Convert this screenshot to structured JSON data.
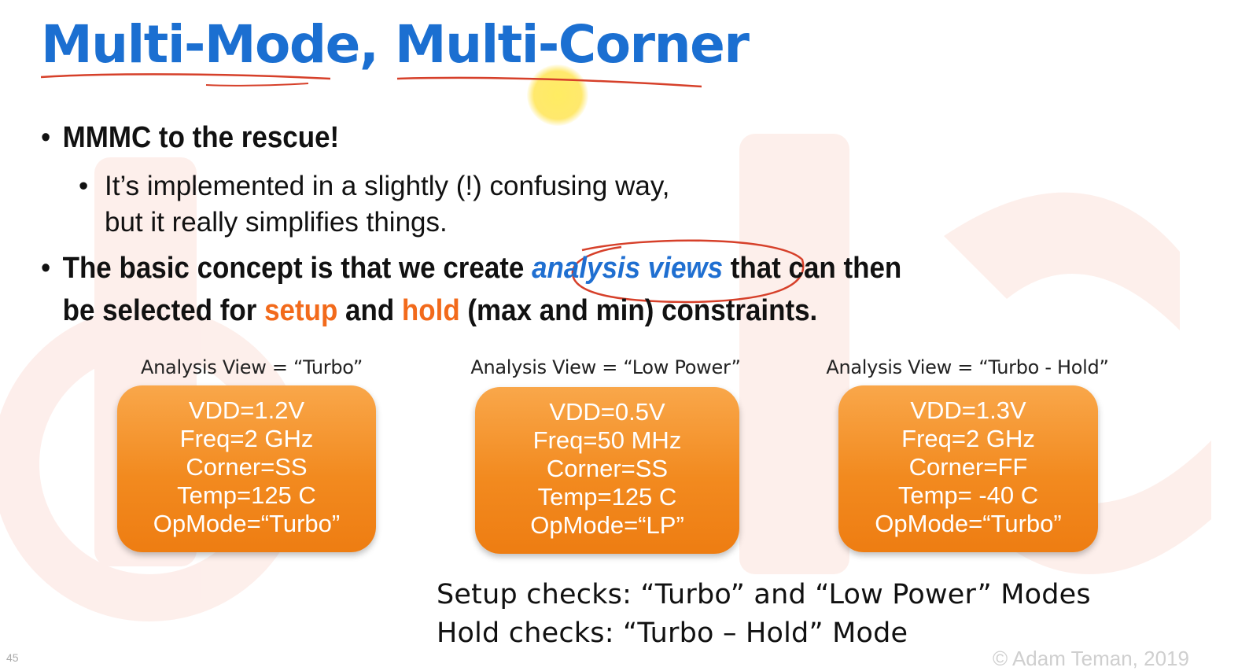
{
  "slide": {
    "title": "Multi-Mode, Multi-Corner",
    "bullets": {
      "b1": "MMMC to the rescue!",
      "b1_sub_line1": "It’s implemented in a slightly (!) confusing way,",
      "b1_sub_line2": "but it really simplifies things.",
      "b2_part1": "The basic concept is that we create ",
      "b2_highlight": "analysis views",
      "b2_part2": " that can then",
      "b2_line2_part1": "be selected for ",
      "b2_setup": "setup",
      "b2_and": " and ",
      "b2_hold": "hold",
      "b2_line2_part2": " (max and min) constraints."
    },
    "views": [
      {
        "label": "Analysis View = “Turbo”",
        "vdd": "VDD=1.2V",
        "freq": "Freq=2 GHz",
        "corner": "Corner=SS",
        "temp": "Temp=125 C",
        "opmode": "OpMode=“Turbo”"
      },
      {
        "label": "Analysis View = “Low Power”",
        "vdd": "VDD=0.5V",
        "freq": "Freq=50 MHz",
        "corner": "Corner=SS",
        "temp": "Temp=125 C",
        "opmode": "OpMode=“LP”"
      },
      {
        "label": "Analysis View = “Turbo - Hold”",
        "vdd": "VDD=1.3V",
        "freq": "Freq=2 GHz",
        "corner": "Corner=FF",
        "temp": "Temp= -40 C",
        "opmode": "OpMode=“Turbo”"
      }
    ],
    "checks": {
      "setup": "Setup checks: “Turbo” and “Low Power” Modes",
      "hold": "Hold checks: “Turbo – Hold” Mode"
    },
    "footer": {
      "copyright": "© Adam Teman, 2019",
      "slide_number": "45"
    }
  },
  "colors": {
    "title_blue": "#1b6fd1",
    "highlight_orange": "#f26a1b",
    "box_orange": "#f28a1f",
    "annotation_red": "#d6402a",
    "pointer_yellow": "#ffe13c"
  }
}
